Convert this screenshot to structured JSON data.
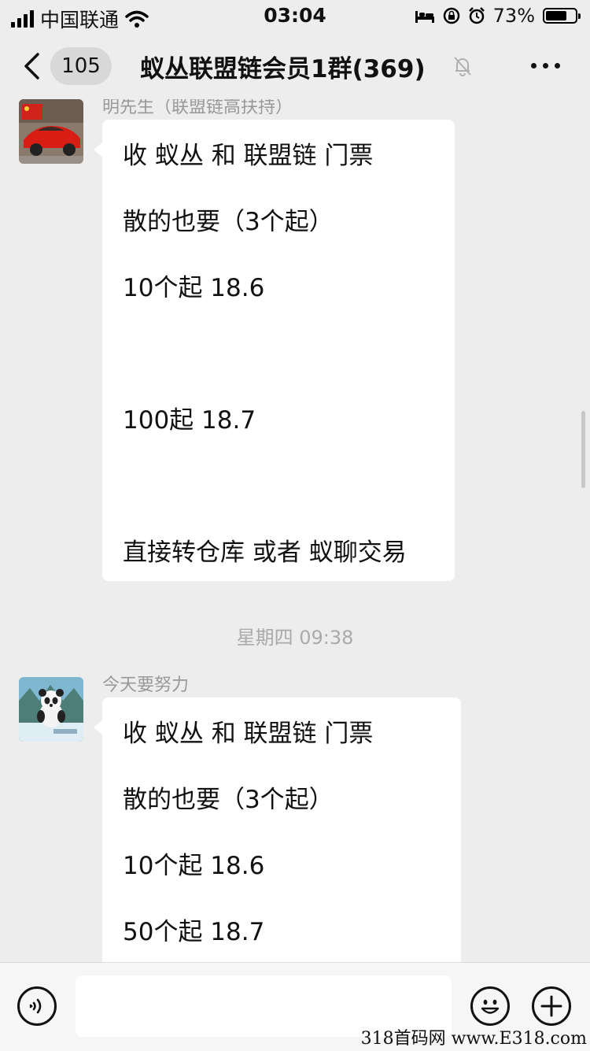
{
  "status_bar": {
    "carrier": "中国联通",
    "time": "03:04",
    "battery_percent": "73%",
    "battery_level": 0.73,
    "icons": [
      "signal-icon",
      "wifi-icon",
      "bed-icon",
      "rotation-lock-icon",
      "alarm-icon",
      "battery-icon"
    ]
  },
  "nav": {
    "unread_count": "105",
    "title": "蚁丛联盟链会员1群(369)",
    "icons": [
      "chevron-left-icon",
      "bell-muted-icon",
      "more-dots-icon"
    ]
  },
  "messages": [
    {
      "sender": "明先生（联盟链高扶持）",
      "lines": [
        "收 蚁丛 和 联盟链 门票",
        "散的也要（3个起）",
        "10个起 18.6",
        "100起 18.7",
        "直接转仓库 或者 蚁聊交易"
      ]
    },
    {
      "sender": "今天要努力",
      "lines": [
        "收 蚁丛 和 联盟链 门票",
        "散的也要（3个起）",
        "10个起 18.6",
        "50个起 18.7"
      ]
    }
  ],
  "timestamp": "星期四 09:38",
  "input_bar": {
    "icons": [
      "voice-icon",
      "emoji-icon",
      "plus-icon"
    ],
    "value": ""
  },
  "watermark": "318首码网 www.E318.com",
  "colors": {
    "background": "#ededed",
    "bubble": "#ffffff",
    "meta_text": "#999999"
  }
}
